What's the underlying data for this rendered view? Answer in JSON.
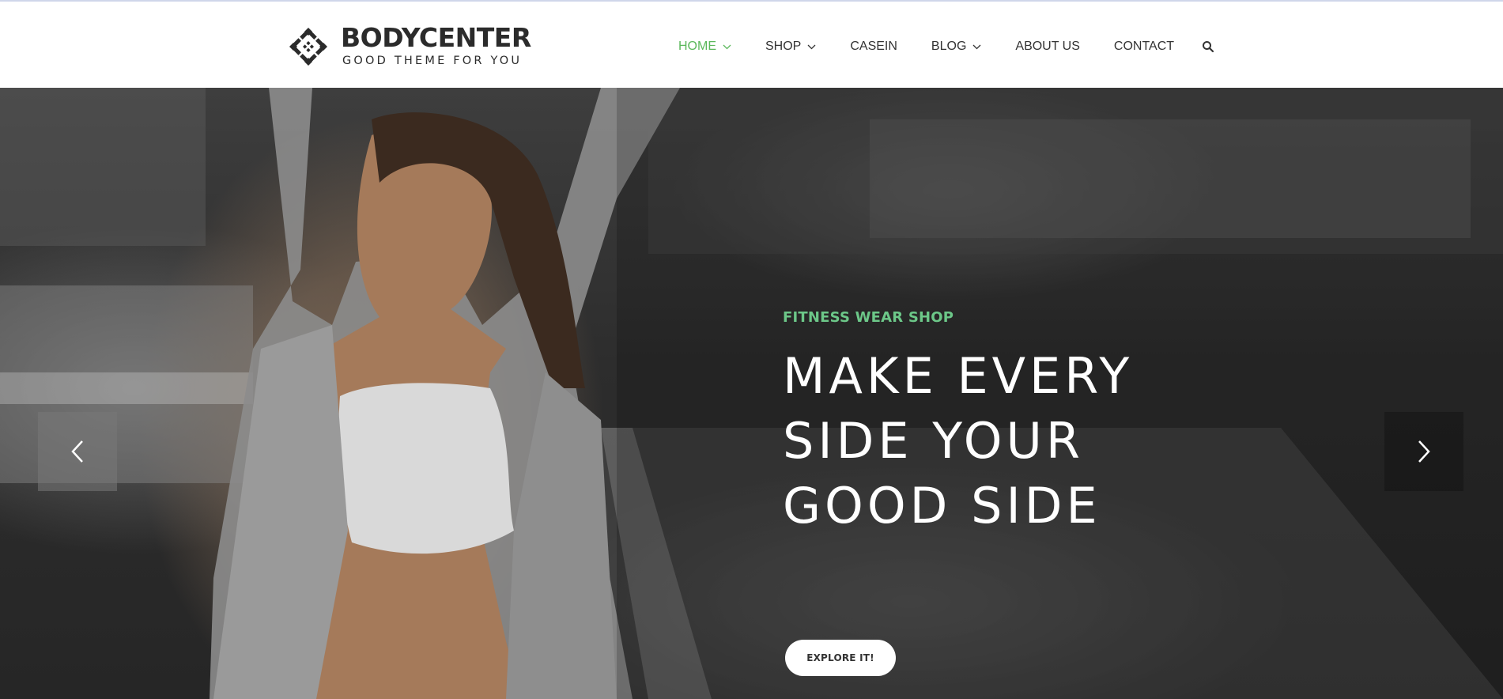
{
  "brand": {
    "name": "BODYCENTER",
    "tagline": "GOOD THEME FOR YOU"
  },
  "nav": {
    "items": [
      {
        "label": "HOME",
        "active": true,
        "has_dropdown": true
      },
      {
        "label": "SHOP",
        "active": false,
        "has_dropdown": true
      },
      {
        "label": "CASEIN",
        "active": false,
        "has_dropdown": false
      },
      {
        "label": "BLOG",
        "active": false,
        "has_dropdown": true
      },
      {
        "label": "ABOUT US",
        "active": false,
        "has_dropdown": false
      },
      {
        "label": "CONTACT",
        "active": false,
        "has_dropdown": false
      }
    ],
    "search_icon": "search-icon"
  },
  "hero": {
    "eyebrow": "FITNESS WEAR SHOP",
    "headline": [
      "MAKE EVERY",
      "SIDE YOUR",
      "GOOD SIDE"
    ],
    "cta_label": "EXPLORE IT!",
    "prev_icon": "chevron-left-icon",
    "next_icon": "chevron-right-icon"
  },
  "colors": {
    "accent": "#5cb85c",
    "eyebrow": "#6cc788",
    "text_dark": "#333333",
    "white": "#ffffff"
  }
}
